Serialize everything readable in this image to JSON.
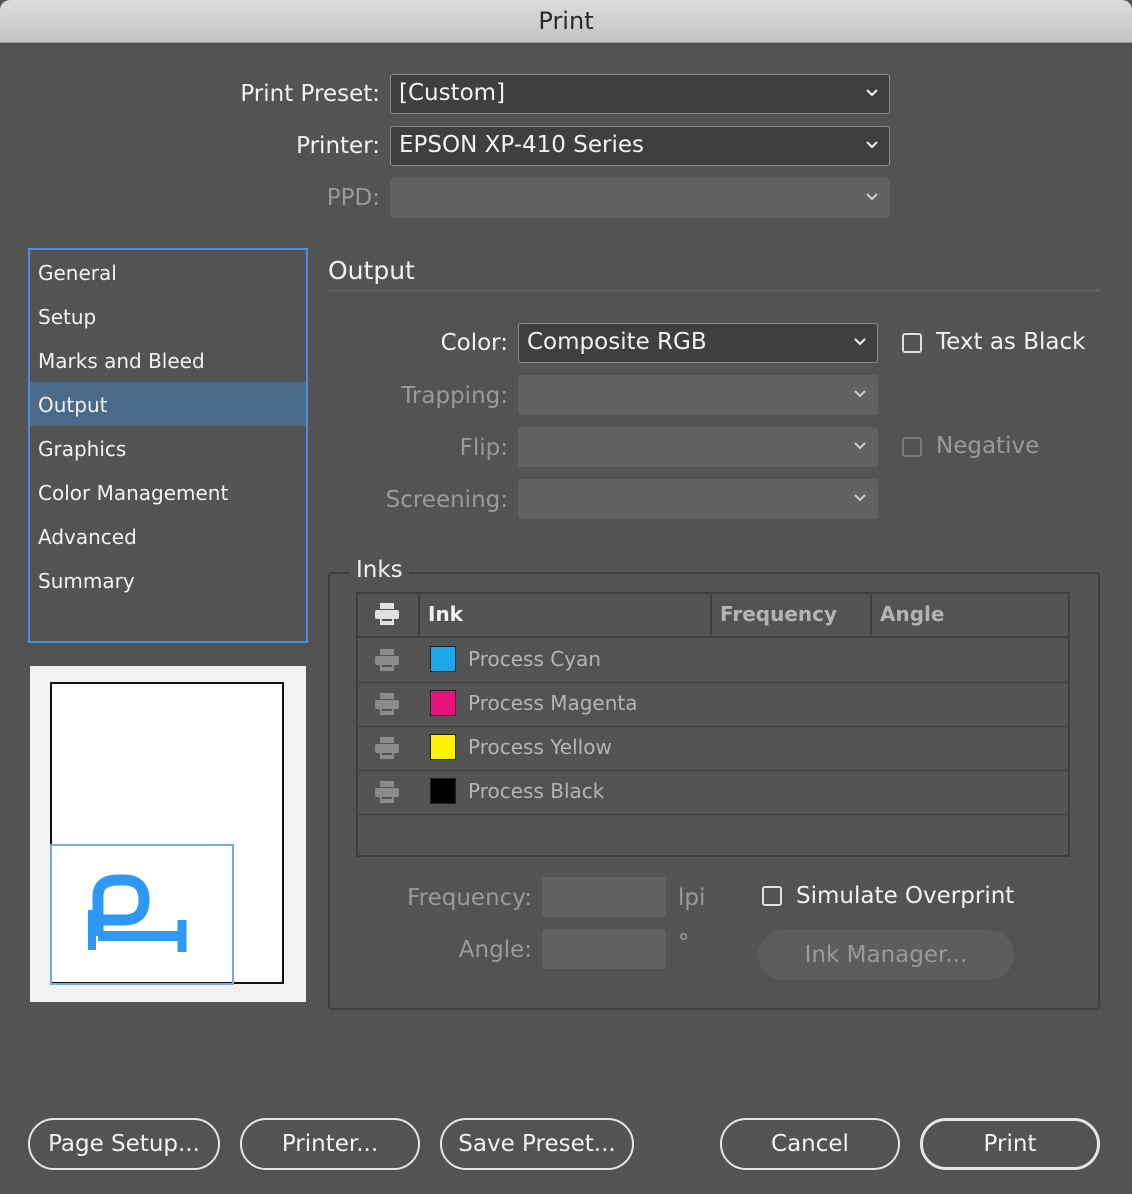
{
  "window": {
    "title": "Print"
  },
  "top": {
    "preset_label": "Print Preset:",
    "preset_value": "[Custom]",
    "printer_label": "Printer:",
    "printer_value": "EPSON XP-410 Series",
    "ppd_label": "PPD:",
    "ppd_value": ""
  },
  "sidebar": {
    "items": [
      {
        "label": "General"
      },
      {
        "label": "Setup"
      },
      {
        "label": "Marks and Bleed"
      },
      {
        "label": "Output"
      },
      {
        "label": "Graphics"
      },
      {
        "label": "Color Management"
      },
      {
        "label": "Advanced"
      },
      {
        "label": "Summary"
      }
    ],
    "selected": "Output"
  },
  "preview": {
    "glyph": "P",
    "accent": "#2f97f5"
  },
  "output": {
    "title": "Output",
    "color_label": "Color:",
    "color_value": "Composite RGB",
    "text_as_black_label": "Text as Black",
    "text_as_black_checked": false,
    "trapping_label": "Trapping:",
    "flip_label": "Flip:",
    "screening_label": "Screening:",
    "negative_label": "Negative",
    "negative_checked": false
  },
  "inks": {
    "legend": "Inks",
    "columns": [
      "Ink",
      "Frequency",
      "Angle"
    ],
    "rows": [
      {
        "name": "Process Cyan",
        "color": "#1aa8ea",
        "frequency": "",
        "angle": ""
      },
      {
        "name": "Process Magenta",
        "color": "#e8127c",
        "frequency": "",
        "angle": ""
      },
      {
        "name": "Process Yellow",
        "color": "#fff200",
        "frequency": "",
        "angle": ""
      },
      {
        "name": "Process Black",
        "color": "#000000",
        "frequency": "",
        "angle": ""
      }
    ],
    "frequency_label": "Frequency:",
    "frequency_unit": "lpi",
    "angle_label": "Angle:",
    "angle_unit": "°",
    "simulate_overprint_label": "Simulate Overprint",
    "simulate_overprint_checked": false,
    "ink_manager_label": "Ink Manager..."
  },
  "buttons": {
    "page_setup": "Page Setup...",
    "printer": "Printer...",
    "save_preset": "Save Preset...",
    "cancel": "Cancel",
    "print": "Print"
  },
  "colors": {
    "background": "#535353",
    "selection": "#4b6a8a",
    "focus_ring": "#4a90d9"
  }
}
